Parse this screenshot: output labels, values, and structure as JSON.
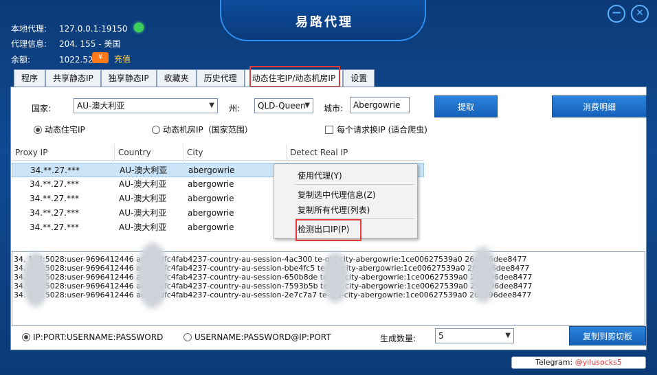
{
  "title": "易路代理",
  "window_buttons": {
    "minimize": "−",
    "close": "✕"
  },
  "info": {
    "local_label": "本地代理:",
    "local_value": "127.0.0.1:19150",
    "proxy_label": "代理信息:",
    "proxy_value": "204.         155 - 美国",
    "balance_label": "余额:",
    "balance_value": "1022.52",
    "recharge_icon": "¥",
    "recharge_label": "充值"
  },
  "tabs": [
    "程序",
    "共享静态IP",
    "独享静态IP",
    "收藏夹",
    "历史代理",
    "动态住宅IP/动态机房IP",
    "设置"
  ],
  "filters": {
    "country_label": "国家:",
    "country_value": "AU-澳大利亚",
    "state_label": "州:",
    "state_value": "QLD-Queen",
    "city_label": "城市:",
    "city_value": "Abergowrie",
    "extract_button": "提取",
    "consume_button": "消费明细",
    "radio_residential": "动态住宅IP",
    "radio_datacenter": "动态机房IP（国家范围）",
    "checkbox_rotate": "每个请求换IP (适合爬虫)"
  },
  "grid": {
    "headers": [
      "Proxy IP",
      "Country",
      "City",
      "Detect Real IP"
    ],
    "rows": [
      [
        "34.**.27.***",
        "AU-澳大利亚",
        "abergowrie"
      ],
      [
        "34.**.27.***",
        "AU-澳大利亚",
        "abergowrie"
      ],
      [
        "34.**.27.***",
        "AU-澳大利亚",
        "abergowrie"
      ],
      [
        "34.**.27.***",
        "AU-澳大利亚",
        "abergowrie"
      ],
      [
        "34.**.27.***",
        "AU-澳大利亚",
        "abergowrie"
      ]
    ]
  },
  "context_menu": {
    "use_proxy": "使用代理(Y)",
    "copy_selected": "复制选中代理信息(Z)",
    "copy_all": "复制所有代理(列表)",
    "check_ip": "检测出口IP(P)"
  },
  "output_lines": [
    "34.       123:5028:user-9696412446        ac622dfc4fab4237-country-au-session-4ac300        te-qld-city-abergowrie:1ce00627539a0        26ad96dee8477",
    "34.       123:5028:user-9696412446        ac622dfc4fab4237-country-au-session-bbe4fc5        te-qld-city-abergowrie:1ce00627539a0        26ad96dee8477",
    "34.       123:5028:user-9696412446        ac622dfc4fab4237-country-au-session-650b8de        te-qld-city-abergowrie:1ce00627539a0        26ad96dee8477",
    "34.       123:5028:user-9696412446        ac622dfc4fab4237-country-au-session-7593b5b        te-qld-city-abergowrie:1ce00627539a0        26ad96dee8477",
    "34.       123:5028:user-9696412446        ac622dfc4fab4237-country-au-session-2e7c7a7        te-qld-city-abergowrie:1ce00627539a0        26ad96dee8477"
  ],
  "format": {
    "option1": "IP:PORT:USERNAME:PASSWORD",
    "option2": "USERNAME:PASSWORD@IP:PORT",
    "count_label": "生成数量:",
    "count_value": "5",
    "copy_button": "复制到剪切板"
  },
  "telegram": {
    "label": "Telegram: ",
    "handle": "@yilusocks5"
  },
  "colors": {
    "accent": "#1761b8",
    "highlight": "#e03a3a",
    "recharge": "#ffd84a"
  }
}
